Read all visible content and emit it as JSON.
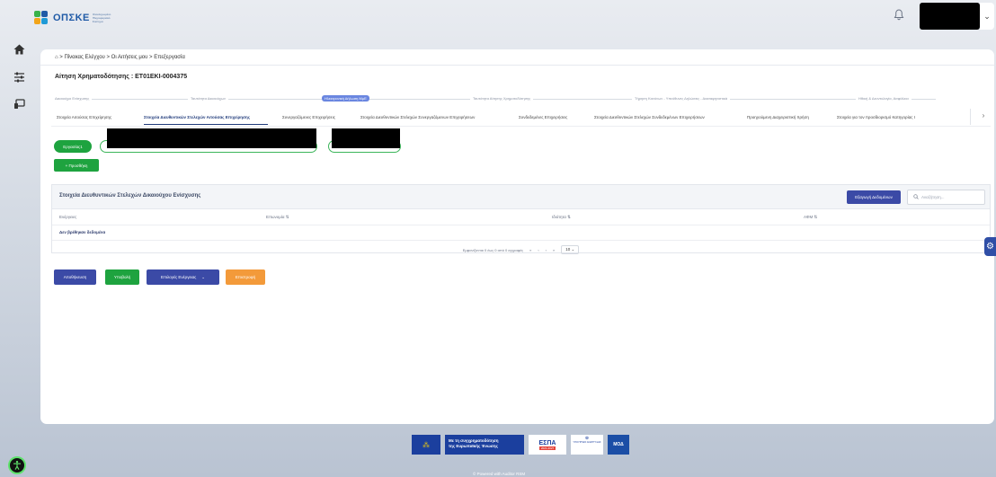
{
  "header": {
    "logo_text": "ΟΠΣΚΕ",
    "logo_subtitle": "Ολοκληρωμένο Πληροφοριακό Σύστημα",
    "icons": [
      "home-icon",
      "sliders-icon",
      "monitor-icon",
      "bell-icon",
      "chevron-down-icon"
    ]
  },
  "breadcrumb": {
    "text": "⌂ > Πίνακας Ελέγχου > Οι Αιτήσεις μου > Επεξεργασία"
  },
  "page": {
    "title": "Αίτηση Χρηματοδότησης : ΕΤ01ΕΚΙ-0004375"
  },
  "stepper": [
    {
      "label": "Δικαιούχοι Ενίσχυσης",
      "active": false
    },
    {
      "label": "Ταυτότητα Δικαιούχων",
      "active": false
    },
    {
      "label": "Ηλεκτρονική Δήλωση ΜμΕ",
      "active": true
    },
    {
      "label": "Ταυτότητα Αίτησης Χρηματοδότησης",
      "active": false
    },
    {
      "label": "Τήρηση Κανόνων - Υπεύθυνες Δηλώσεις - Διασαφηνιστικά",
      "active": false
    },
    {
      "label": "Ηθική & Δεοντολογία, Ασφάλεια",
      "active": false
    }
  ],
  "tabs": [
    {
      "label": "Στοιχεία Αιτούσας Επιχείρησης",
      "active": false
    },
    {
      "label": "Στοιχεία Διευθυντικών Στελεχών Αιτούσας Επιχείρησης",
      "active": true
    },
    {
      "label": "Συνεργαζόμενες Επιχειρήσεις",
      "active": false
    },
    {
      "label": "Στοιχεία Διευθυντικών Στελεχών Συνεργαζόμενων Επιχειρήσεων",
      "active": false
    },
    {
      "label": "Συνδεδεμένες Επιχειρήσεις",
      "active": false
    },
    {
      "label": "Στοιχεία Διευθυντικών Στελεχών Συνδεδεμένων Επιχειρήσεων",
      "active": false
    },
    {
      "label": "Προηγούμενη Διαχειριστική Χρήση",
      "active": false
    },
    {
      "label": "Στοιχεία για τον προσδιορισμό Κατηγορίας Ι",
      "active": false
    }
  ],
  "entities": {
    "selected_label": "Εργασίας1"
  },
  "buttons": {
    "add": "+ Προσθήκη",
    "save": "Αποθήκευση",
    "submit": "Υποβολή",
    "actions": "Επιλογές Ενέργειας",
    "back": "Επιστροφή"
  },
  "table": {
    "title": "Στοιχεία Διευθυντικών Στελεχών Δικαιούχου Ενίσχυσης",
    "export_label": "Εξαγωγή Δεδομένων",
    "search_placeholder": "Αναζήτηση...",
    "columns": [
      "Ενέργειες",
      "Επωνυμία",
      "Ιδιότητα",
      "ΑΦΜ"
    ],
    "sort_marker": "⇅",
    "empty_message": "Δεν βρέθηκαν δεδομένα",
    "pagination_info": "Εμφανίζονται 0 έως 0 από 0 εγγραφές",
    "page_size": "10"
  },
  "footer": {
    "eu_text_line1": "Με τη συγχρηματοδότηση",
    "eu_text_line2": "της Ευρωπαϊκής Ένωσης",
    "espa_title": "ΕΣΠΑ",
    "espa_years": "2021-2027",
    "ministry_text": "ΥΠΟΥΡΓΕΙΟ ΑΝΑΠΤΥΞΗΣ",
    "moa_text": "ΜΟΔ",
    "powered": "© Powered with Auditor RSM"
  }
}
